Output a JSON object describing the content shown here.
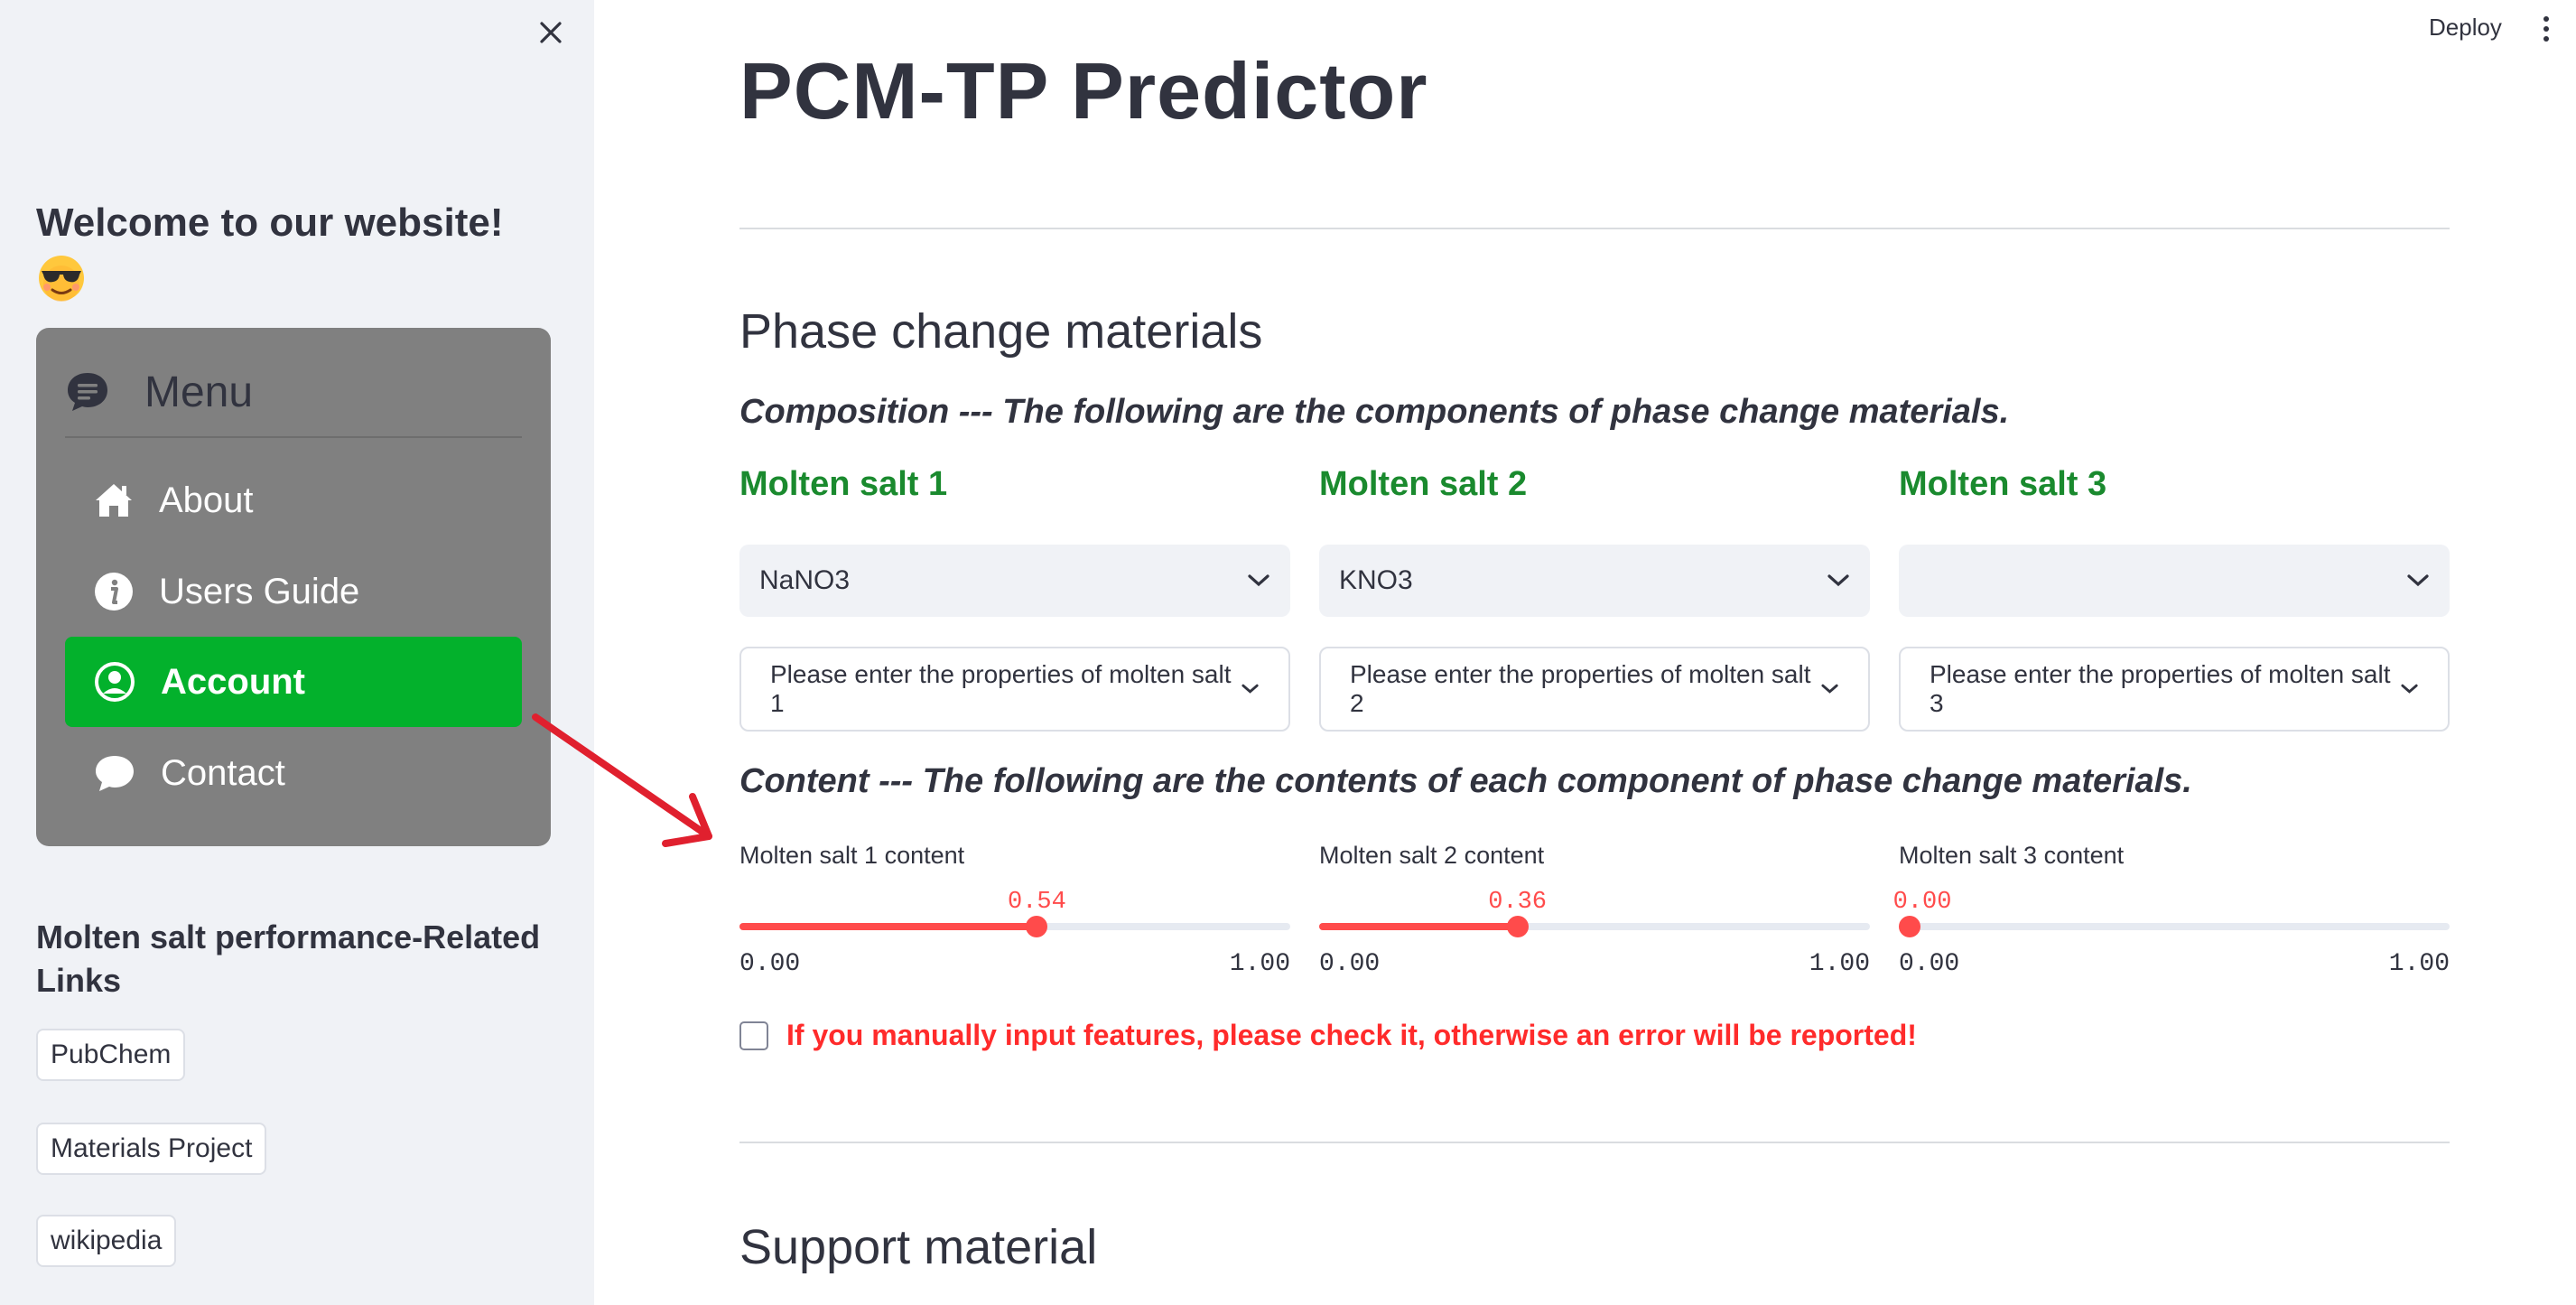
{
  "sidebar": {
    "welcome": "Welcome to our website!",
    "menu": {
      "title": "Menu",
      "items": [
        {
          "label": "About",
          "icon": "house-icon"
        },
        {
          "label": "Users Guide",
          "icon": "info-circle-icon"
        },
        {
          "label": "Account",
          "icon": "person-circle-icon",
          "active": true
        },
        {
          "label": "Contact",
          "icon": "chat-icon"
        }
      ]
    },
    "links_title": "Molten salt performance-Related Links",
    "links": [
      "PubChem",
      "Materials Project",
      "wikipedia"
    ]
  },
  "header": {
    "deploy": "Deploy"
  },
  "main": {
    "title": "PCM-TP Predictor",
    "phase_section": {
      "title": "Phase change materials",
      "composition_caption": "Composition --- The following are the components of phase change materials.",
      "salts": [
        {
          "label": "Molten salt 1",
          "selected": "NaNO3",
          "expander": "Please enter the properties of molten salt 1"
        },
        {
          "label": "Molten salt 2",
          "selected": "KNO3",
          "expander": "Please enter the properties of molten salt 2"
        },
        {
          "label": "Molten salt 3",
          "selected": "",
          "expander": "Please enter the properties of molten salt 3"
        }
      ],
      "content_caption": "Content --- The following are the contents of each component of phase change materials.",
      "sliders": [
        {
          "label": "Molten salt 1 content",
          "value": "0.54",
          "fraction": 0.54,
          "min": "0.00",
          "max": "1.00"
        },
        {
          "label": "Molten salt 2 content",
          "value": "0.36",
          "fraction": 0.36,
          "min": "0.00",
          "max": "1.00"
        },
        {
          "label": "Molten salt 3 content",
          "value": "0.00",
          "fraction": 0.0,
          "min": "0.00",
          "max": "1.00"
        }
      ],
      "checkbox_label": "If you manually input features, please check it, otherwise an error will be reported!"
    },
    "support_section": {
      "title": "Support material"
    }
  },
  "colors": {
    "accent": "#ff4b4b",
    "menu_active": "#03b12c",
    "salt_label": "#1a8a2e",
    "warning": "#ff2b2b",
    "annotation_arrow": "#e0202e"
  }
}
